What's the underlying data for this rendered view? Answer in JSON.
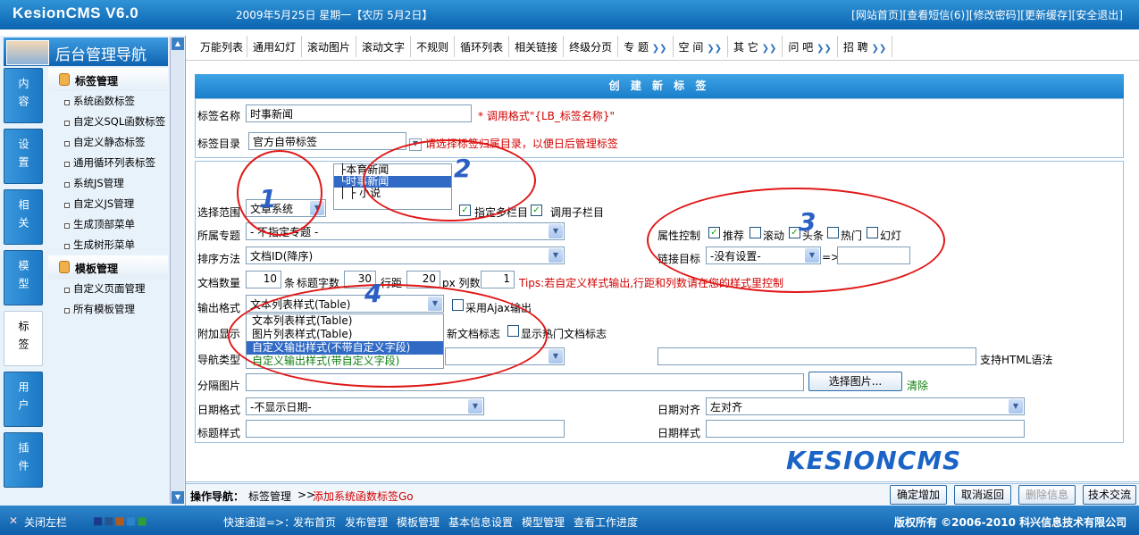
{
  "app": {
    "logo": "KesionCMS V6.0",
    "date": "2009年5月25日 星期一【农历 5月2日】",
    "links": "[网站首页][查看短信(6)][修改密码][更新缓存][安全退出]"
  },
  "sidebar": {
    "title": "后台管理导航",
    "vtabs": [
      "内容",
      "设置",
      "相关",
      "模型",
      "标签",
      "用户",
      "插件"
    ],
    "groups": [
      {
        "label": "标签管理",
        "items": [
          "系统函数标签",
          "自定义SQL函数标签",
          "自定义静态标签",
          "通用循环列表标签",
          "系统JS管理",
          "自定义JS管理",
          "生成顶部菜单",
          "生成树形菜单"
        ]
      },
      {
        "label": "模板管理",
        "items": [
          "自定义页面管理",
          "所有模板管理"
        ]
      }
    ]
  },
  "tabs": [
    "万能列表",
    "通用幻灯",
    "滚动图片",
    "滚动文字",
    "不规则",
    "循环列表",
    "相关链接",
    "终级分页"
  ],
  "tabs_dd": [
    "专 题",
    "空 间",
    "其 它",
    "问 吧",
    "招 聘"
  ],
  "form": {
    "title": "创 建 新 标 签",
    "name_label": "标签名称",
    "name_value": "时事新闻",
    "name_hint": "* 调用格式\"{LB_标签名称}\"",
    "dir_label": "标签目录",
    "dir_value": "官方自带标签",
    "dir_hint": "请选择标签归属目录，以便日后管理标签",
    "scope_label": "选择范围",
    "scope_value": "文章系统",
    "tree": [
      "├本育新闻",
      "└时事新闻",
      "│ ├ 小说"
    ],
    "multi_label": "指定多栏目",
    "sub_label": "调用子栏目",
    "topic_label": "所属专题",
    "topic_value": "- 不指定专题 -",
    "attr_label": "属性控制",
    "attrs": [
      "推荐",
      "滚动",
      "头条",
      "热门",
      "幻灯"
    ],
    "sort_label": "排序方法",
    "sort_value": "文档ID(降序)",
    "target_label": "链接目标",
    "target_value": "-没有设置-",
    "count_label": "文档数量",
    "count_value": "10",
    "count_unit": "条",
    "tlen_label": "标题字数",
    "tlen_value": "30",
    "row_label": "行距",
    "row_value": "20",
    "col_unit": "px 列数",
    "col_value": "1",
    "tips": "Tips:若自定义样式输出,行距和列数请在您的样式里控制",
    "out_label": "输出格式",
    "out_value": "文本列表样式(Table)",
    "ajax_label": "采用Ajax输出",
    "out_options": [
      "文本列表样式(Table)",
      "图片列表样式(Table)",
      "自定义输出样式(不带自定义字段)",
      "自定义输出样式(带自定义字段)"
    ],
    "extra_label": "附加显示",
    "new_label": "新文档标志",
    "hot_label": "显示热门文档标志",
    "nav_label": "导航类型",
    "html_label": "支持HTML语法",
    "sep_label": "分隔图片",
    "pick_btn": "选择图片...",
    "clear": "清除",
    "date_label": "日期格式",
    "date_value": "-不显示日期-",
    "dalign_label": "日期对齐",
    "dalign_value": "左对齐",
    "tstyle_label": "标题样式",
    "dstyle_label": "日期样式"
  },
  "annotations": [
    "1",
    "2",
    "3",
    "4"
  ],
  "watermark": "KESIONCMS",
  "bottom": {
    "nav": "操作导航：",
    "crumb": "标签管理",
    "arrow": ">>",
    "current": "添加系统函数标签Go",
    "buttons": [
      "确定增加",
      "取消返回",
      "删除信息",
      "技术交流"
    ]
  },
  "status": {
    "close": "关闭左栏",
    "quick": "快速通道=>：",
    "links": [
      "发布首页",
      "发布管理",
      "模板管理",
      "基本信息设置",
      "模型管理",
      "查看工作进度"
    ],
    "copyright": "版权所有 ©2006-2010 科兴信息技术有限公司"
  }
}
